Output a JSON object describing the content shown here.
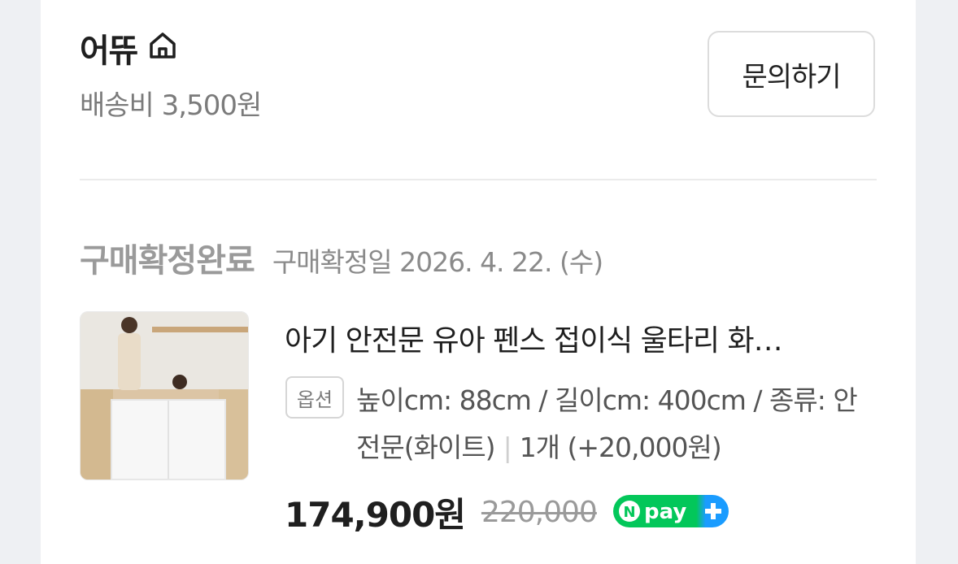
{
  "seller": {
    "name": "어뜌",
    "home_icon": "home-icon",
    "shipping": "배송비 3,500원",
    "inquiry_label": "문의하기"
  },
  "order": {
    "status": "구매확정완료",
    "confirm_date": "구매확정일 2026. 4. 22. (수)"
  },
  "product": {
    "title": "아기 안전문 유아 펜스 접이식 울타리 화…",
    "option_badge": "옵션",
    "options_line1": "높이cm: 88cm / 길이cm: 400cm / 종류: 안",
    "options_line2": "전문(화이트)",
    "quantity": "1개 (+20,000원)",
    "price": "174,900원",
    "original_price": "220,000",
    "npay_label": "pay"
  },
  "colors": {
    "npay_green": "#03c75a",
    "npay_blue": "#1a9cff"
  }
}
